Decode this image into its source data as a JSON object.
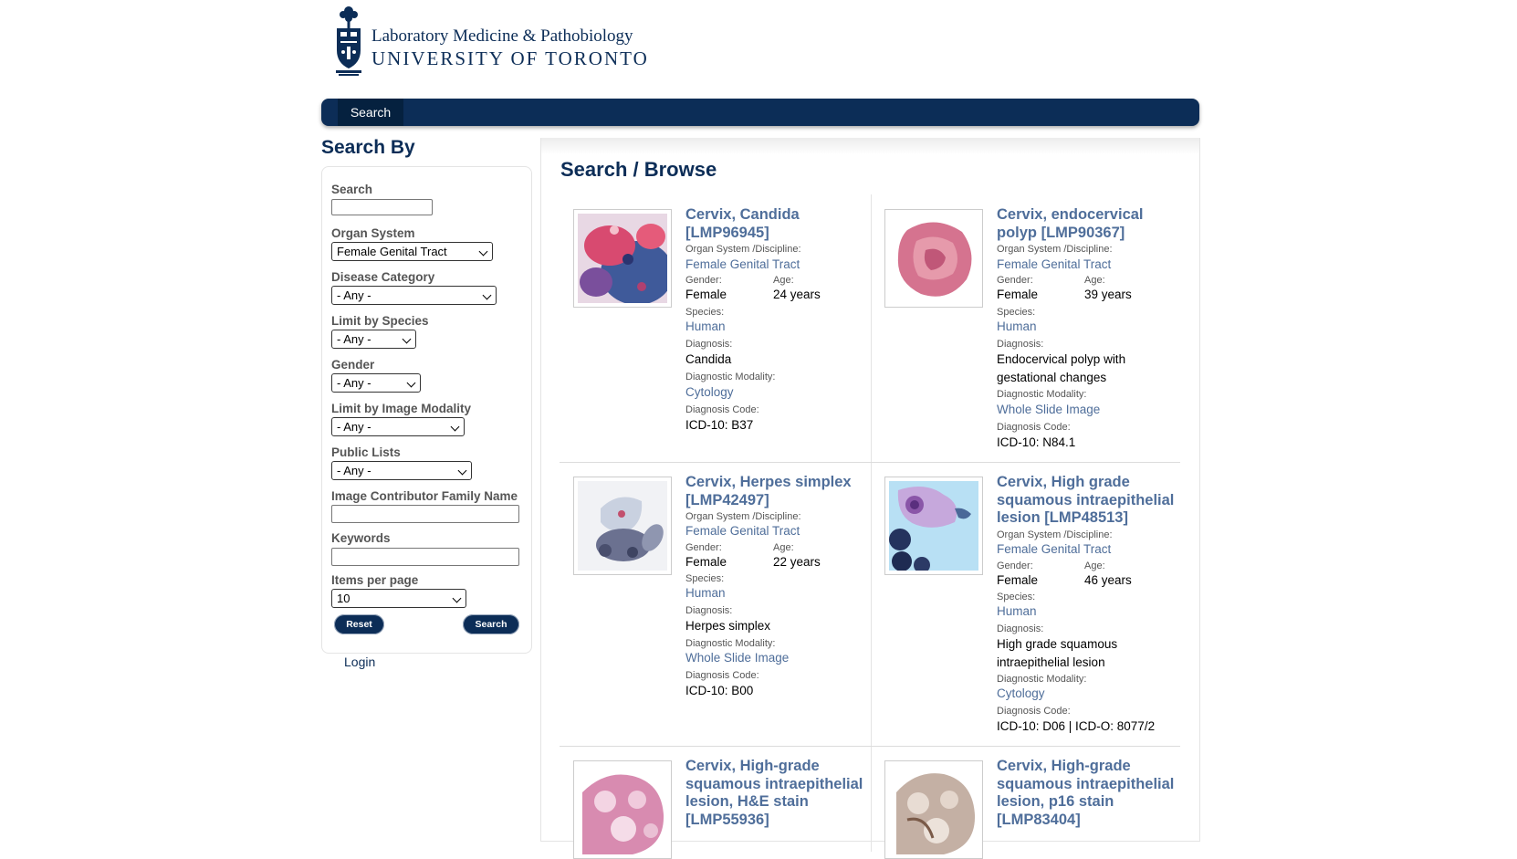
{
  "header": {
    "logo_line1": "Laboratory Medicine & Pathobiology",
    "logo_line2": "UNIVERSITY OF TORONTO"
  },
  "nav": {
    "search": "Search"
  },
  "sidebar": {
    "title": "Search By",
    "search_label": "Search",
    "organ_label": "Organ System",
    "organ_value": "Female Genital Tract",
    "disease_label": "Disease Category",
    "disease_value": "- Any -",
    "species_label": "Limit by Species",
    "species_value": "- Any -",
    "gender_label": "Gender",
    "gender_value": "- Any -",
    "modality_label": "Limit by Image Modality",
    "modality_value": "- Any -",
    "lists_label": "Public Lists",
    "lists_value": "- Any -",
    "contributor_label": "Image Contributor Family Name",
    "keywords_label": "Keywords",
    "items_label": "Items per page",
    "items_value": "10",
    "reset": "Reset",
    "search_button": "Search",
    "login": "Login"
  },
  "main": {
    "title": "Search / Browse",
    "field_labels": {
      "organ": "Organ System /Discipline:",
      "gender": "Gender:",
      "age": "Age:",
      "species": "Species:",
      "diagnosis": "Diagnosis:",
      "modality": "Diagnostic Modality:",
      "code": "Diagnosis Code:"
    },
    "results": [
      {
        "title": "Cervix, Candida [LMP96945]",
        "organ": "Female Genital Tract",
        "gender": "Female",
        "age": "24 years",
        "species": "Human",
        "diagnosis": "Candida",
        "modality": "Cytology",
        "code": "ICD-10: B37"
      },
      {
        "title": "Cervix, endocervical polyp [LMP90367]",
        "organ": "Female Genital Tract",
        "gender": "Female",
        "age": "39 years",
        "species": "Human",
        "diagnosis_line1": "Endocervical polyp with",
        "diagnosis_line2": "gestational changes",
        "modality": "Whole Slide Image",
        "code": "ICD-10: N84.1"
      },
      {
        "title": "Cervix, Herpes simplex [LMP42497]",
        "organ": "Female Genital Tract",
        "gender": "Female",
        "age": "22 years",
        "species": "Human",
        "diagnosis": "Herpes simplex",
        "modality": "Whole Slide Image",
        "code": "ICD-10: B00"
      },
      {
        "title": "Cervix, High grade squamous intraepithelial lesion [LMP48513]",
        "organ": "Female Genital Tract",
        "gender": "Female",
        "age": "46 years",
        "species": "Human",
        "diagnosis_line1": "High grade squamous",
        "diagnosis_line2": "intraepithelial lesion",
        "modality": "Cytology",
        "code": "ICD-10: D06 | ICD-O: 8077/2"
      },
      {
        "title": "Cervix, High-grade squamous intraepithelial lesion, H&E stain [LMP55936]"
      },
      {
        "title": "Cervix, High-grade squamous intraepithelial lesion, p16 stain [LMP83404]"
      }
    ]
  }
}
